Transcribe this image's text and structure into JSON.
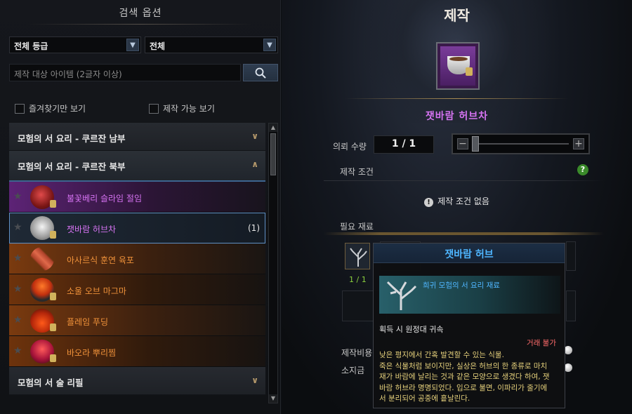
{
  "left": {
    "title": "검색 옵션",
    "grade_select": "전체 등급",
    "type_select": "전체",
    "search_placeholder": "제작 대상 아이템 (2글자 이상)",
    "check_favorites": "즐겨찾기만 보기",
    "check_craftable": "제작 가능 보기",
    "categories": [
      {
        "label": "모험의 서 요리 - 쿠르잔 남부",
        "chevron": "chevron-down"
      },
      {
        "label": "모험의 서 요리 - 쿠르잔 북부",
        "chevron": "chevron-up"
      },
      {
        "label": "모험의 서 술 리필",
        "chevron": "chevron-down"
      }
    ],
    "items": [
      {
        "label": "불꽃베리 슬라임 절임",
        "grade_color": "#d673f2",
        "count": ""
      },
      {
        "label": "잿바람 허브차",
        "grade_color": "#d673f2",
        "count": "(1)"
      },
      {
        "label": "아사르식 훈연 육포",
        "grade_color": "#f0923a",
        "count": ""
      },
      {
        "label": "소울 오브 마그마",
        "grade_color": "#f0923a",
        "count": ""
      },
      {
        "label": "플레임 푸딩",
        "grade_color": "#f0923a",
        "count": ""
      },
      {
        "label": "바오라 뿌리찜",
        "grade_color": "#f0923a",
        "count": ""
      }
    ]
  },
  "right": {
    "title": "제작",
    "item_name": "잿바람 허브차",
    "qty_label": "의뢰 수량",
    "qty_value": "1 / 1",
    "cond_label": "제작 조건",
    "no_condition": "제작 조건 없음",
    "materials_label": "필요 재료",
    "material_count": "1 / 1",
    "cost_label": "제작비용",
    "gold_label": "소지금"
  },
  "tooltip": {
    "name": "잿바람 허브",
    "grade": "희귀 모험의 서 요리 재료",
    "bind": "획득 시 원정대 귀속",
    "trade": "거래 불가",
    "desc_lines": [
      "낮은 평지에서 간혹 발견할 수 있는 식물.",
      "죽은 식물처럼 보이지만, 실상은 허브의 한 종류로 마치",
      "재가 바람에 날리는 것과 같은 모양으로 생겼다 하여, 잿",
      "바람 허브라 명명되었다. 입으로 불면, 이파리가 줄기에",
      "서 분리되어 공중에 흩날린다."
    ]
  },
  "colors": {
    "epic": "#d673f2",
    "legendary": "#f0923a",
    "rare": "#4fb6ff",
    "accent_blue": "#5f90c5"
  },
  "icons": [
    "search-icon",
    "star-icon",
    "chevron-down-icon",
    "chevron-up-icon",
    "help-icon",
    "info-icon",
    "lock-icon",
    "coin-icon"
  ]
}
